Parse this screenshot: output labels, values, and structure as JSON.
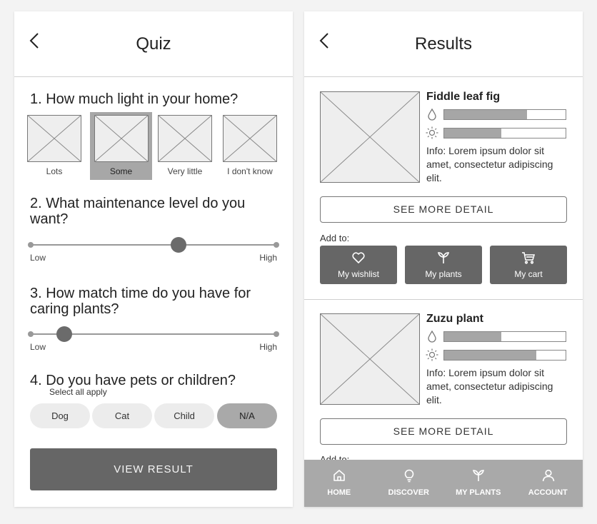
{
  "quiz": {
    "title": "Quiz",
    "back_icon": "chevron-left-icon",
    "q1": {
      "text": "1. How much light in your home?",
      "options": [
        {
          "label": "Lots",
          "selected": false
        },
        {
          "label": "Some",
          "selected": true
        },
        {
          "label": "Very little",
          "selected": false
        },
        {
          "label": "I don't know",
          "selected": false
        }
      ]
    },
    "q2": {
      "text": "2. What maintenance level do you want?",
      "min_label": "Low",
      "max_label": "High",
      "value": 0.6
    },
    "q3": {
      "text": "3. How match time do you have for caring plants?",
      "min_label": "Low",
      "max_label": "High",
      "value": 0.14
    },
    "q4": {
      "text": "4. Do you have pets or children?",
      "subtitle": "Select all apply",
      "options": [
        {
          "label": "Dog",
          "selected": false
        },
        {
          "label": "Cat",
          "selected": false
        },
        {
          "label": "Child",
          "selected": false
        },
        {
          "label": "N/A",
          "selected": true
        }
      ]
    },
    "view_result_label": "VIEW RESULT"
  },
  "results": {
    "title": "Results",
    "back_icon": "chevron-left-icon",
    "items": [
      {
        "name": "Fiddle leaf fig",
        "water_level": 0.68,
        "light_level": 0.47,
        "info": "Info: Lorem ipsum dolor sit amet, consectetur adipiscing elit.",
        "see_more_label": "SEE MORE DETAIL",
        "add_to_label": "Add to:",
        "actions": [
          {
            "label": "My wishlist",
            "icon": "heart-icon"
          },
          {
            "label": "My plants",
            "icon": "sprout-icon"
          },
          {
            "label": "My cart",
            "icon": "cart-icon"
          }
        ]
      },
      {
        "name": "Zuzu plant",
        "water_level": 0.47,
        "light_level": 0.76,
        "info": "Info: Lorem ipsum dolor sit amet, consectetur adipiscing elit.",
        "see_more_label": "SEE MORE DETAIL",
        "add_to_label": "Add to:"
      }
    ]
  },
  "tabbar": {
    "tabs": [
      {
        "label": "HOME",
        "icon": "home-icon"
      },
      {
        "label": "DISCOVER",
        "icon": "lightbulb-icon"
      },
      {
        "label": "MY PLANTS",
        "icon": "sprout-icon"
      },
      {
        "label": "ACCOUNT",
        "icon": "user-icon"
      }
    ]
  }
}
